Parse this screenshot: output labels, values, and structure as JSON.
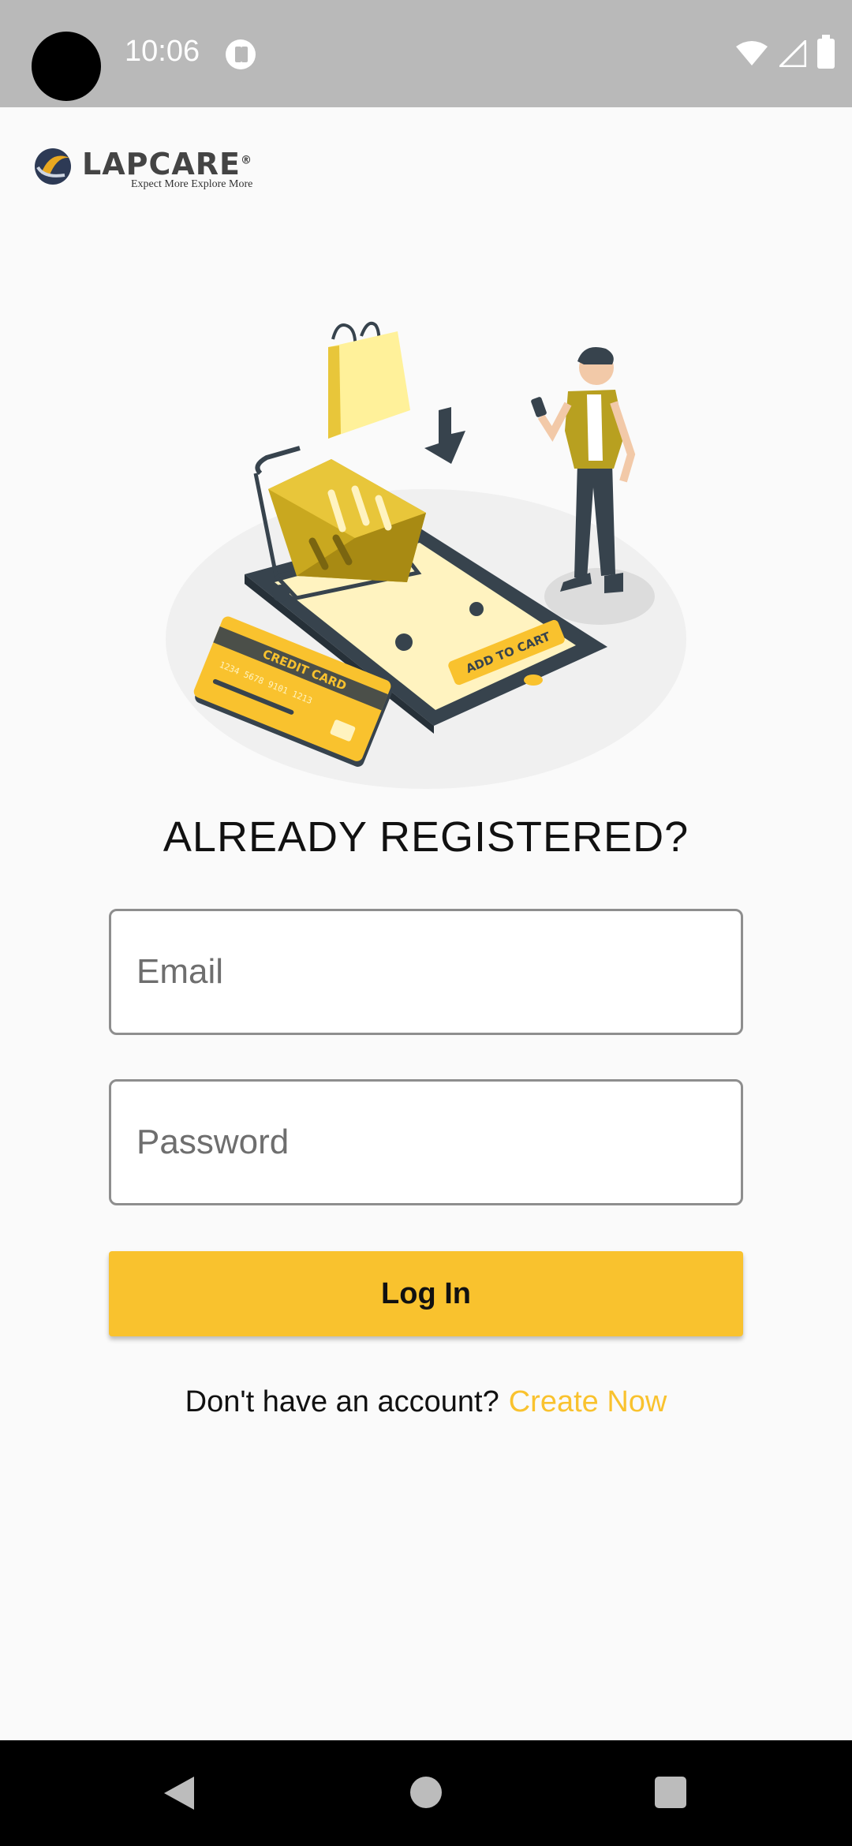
{
  "status_bar": {
    "time": "10:06"
  },
  "logo": {
    "brand": "LAPCARE",
    "registered": "®",
    "tagline": "Expect More Explore More"
  },
  "illustration": {
    "card_label": "CREDIT CARD",
    "card_number": "1234  5678  9101  1213",
    "cart_button": "ADD TO CART",
    "accent_color": "#f9c22e"
  },
  "login": {
    "title": "ALREADY REGISTERED?",
    "email_placeholder": "Email",
    "email_value": "",
    "password_placeholder": "Password",
    "password_value": "",
    "submit_label": "Log In",
    "signup_prompt": "Don't have an account?",
    "signup_link": "Create Now"
  },
  "colors": {
    "accent": "#f9c22e",
    "background": "#fafafa",
    "status_bar": "#b9b9b9",
    "nav_bar": "#000000"
  }
}
